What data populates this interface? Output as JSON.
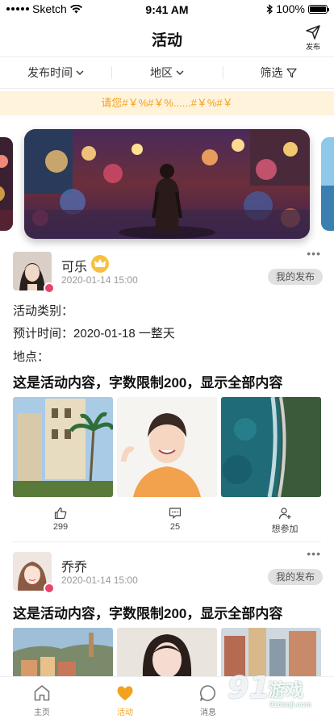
{
  "status_bar": {
    "carrier": "Sketch",
    "time": "9:41 AM",
    "battery": "100%"
  },
  "nav": {
    "title": "活动",
    "publish_label": "发布"
  },
  "filters": [
    {
      "label": "发布时间"
    },
    {
      "label": "地区"
    },
    {
      "label": "筛选"
    }
  ],
  "notice": {
    "text": "请您#￥%#￥%......#￥%#￥"
  },
  "posts": [
    {
      "username": "可乐",
      "time": "2020-01-14  15:00",
      "tag": "我的发布",
      "category_label": "活动类别：",
      "schedule_label": "预计时间：",
      "schedule_value": "2020-01-18 一整天",
      "location_label": "地点：",
      "content": "这是活动内容，字数限制200，显示全部内容",
      "likes": "299",
      "comments": "25",
      "join_label": "想参加"
    },
    {
      "username": "乔乔",
      "time": "2020-01-14  15:00",
      "tag": "我的发布",
      "content": "这是活动内容，字数限制200，显示全部内容"
    }
  ],
  "tabs": [
    {
      "label": "主页",
      "icon": "home-icon"
    },
    {
      "label": "活动",
      "icon": "heart-icon",
      "active": true
    },
    {
      "label": "消息",
      "icon": "chat-icon"
    }
  ],
  "watermark": {
    "text": "游戏",
    "url": "91danji.com",
    "number": "91"
  },
  "colors": {
    "accent": "#f3a21c",
    "notice_bg": "#fff3dc"
  }
}
